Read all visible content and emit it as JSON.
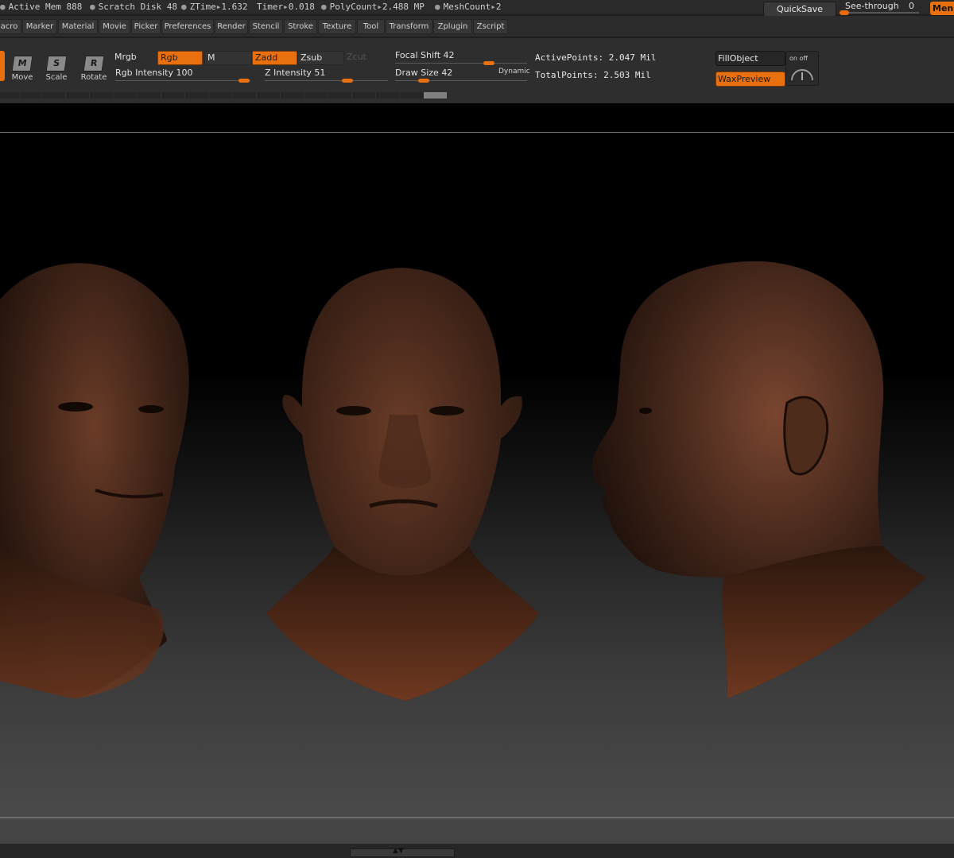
{
  "status": {
    "active_mem": "Active Mem 888",
    "scratch_disk": "Scratch Disk 48",
    "ztime_label": "ZTime",
    "ztime_value": "1.632",
    "timer_label": "Timer",
    "timer_value": "0.018",
    "polycount_label": "PolyCount",
    "polycount_value": "2.488 MP",
    "meshcount_label": "MeshCount",
    "meshcount_value": "2"
  },
  "topright": {
    "quicksave": "QuickSave",
    "see_through_label": "See-through",
    "see_through_value": "0",
    "see_through_level": 0.0,
    "menus": "Menus"
  },
  "menu": [
    "acro",
    "Marker",
    "Material",
    "Movie",
    "Picker",
    "Preferences",
    "Render",
    "Stencil",
    "Stroke",
    "Texture",
    "Tool",
    "Transform",
    "Zplugin",
    "Zscript"
  ],
  "tools": [
    {
      "glyph": "M",
      "label": "Move"
    },
    {
      "glyph": "S",
      "label": "Scale"
    },
    {
      "glyph": "R",
      "label": "Rotate"
    }
  ],
  "color_modes": {
    "mrgb": "Mrgb",
    "rgb": "Rgb",
    "m": "M"
  },
  "z_modes": {
    "zadd": "Zadd",
    "zsub": "Zsub",
    "zcut": "Zcut"
  },
  "sliders": {
    "rgb_intensity_label": "Rgb  Intensity",
    "rgb_intensity_value": "100",
    "z_intensity_label": "Z  Intensity",
    "z_intensity_value": "51",
    "focal_shift_label": "Focal  Shift",
    "focal_shift_value": "42",
    "draw_size_label": "Draw  Size",
    "draw_size_value": "42",
    "dynamic": "Dynamic"
  },
  "info": {
    "active_points_label": "ActivePoints:",
    "active_points_value": "2.047  Mil",
    "total_points_label": "TotalPoints:",
    "total_points_value": "2.503  Mil"
  },
  "right_buttons": {
    "fill_object": "FillObject",
    "wax_preview": "WaxPreview",
    "on_off": "on  off"
  },
  "colors": {
    "accent": "#e8700f",
    "panel": "#2e2e2e",
    "skin": "#5a3322"
  }
}
